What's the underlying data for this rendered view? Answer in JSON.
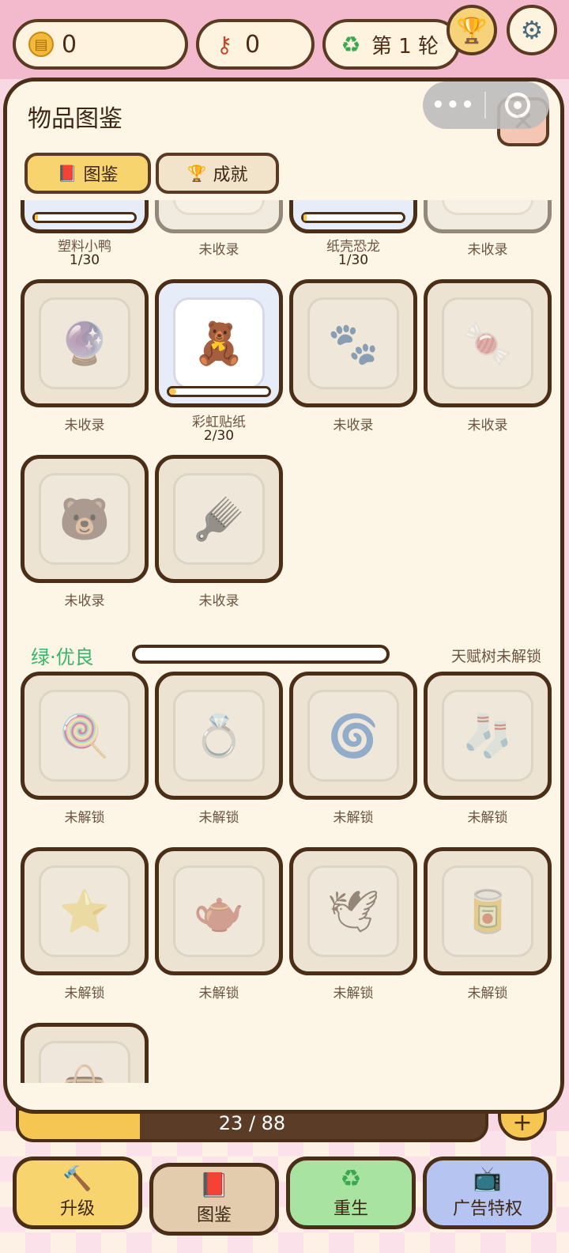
{
  "top_bar": {
    "coins": "0",
    "keys": "0",
    "round": "第 1 轮"
  },
  "panel": {
    "title": "物品图鉴",
    "capsule_more": "•••",
    "close": "✕"
  },
  "tabs": [
    {
      "label": "图鉴",
      "active": true
    },
    {
      "label": "成就",
      "active": false
    }
  ],
  "partial_row": [
    {
      "name": "塑料小鸭",
      "progress": "1/30",
      "collected": true
    },
    {
      "name": "未收录",
      "collected": false
    },
    {
      "name": "纸壳恐龙",
      "progress": "1/30",
      "collected": true
    },
    {
      "name": "未收录",
      "collected": false
    }
  ],
  "white_rows": [
    [
      {
        "name": "未收录",
        "icon": "marble-icon"
      },
      {
        "name": "彩虹贴纸",
        "progress": "2/30",
        "icon": "sticker-box-icon",
        "collected": true
      },
      {
        "name": "未收录",
        "icon": "sticker-sheet-icon"
      },
      {
        "name": "未收录",
        "icon": "swirl-candy-icon"
      }
    ],
    [
      {
        "name": "未收录",
        "icon": "keychain-set-icon"
      },
      {
        "name": "未收录",
        "icon": "comb-set-icon"
      }
    ]
  ],
  "green_section": {
    "title": "绿·优良",
    "status": "天赋树未解锁",
    "items": [
      {
        "name": "未解锁",
        "icon": "bear-lollipop-icon",
        "emoji": "🍭"
      },
      {
        "name": "未解锁",
        "icon": "heart-ring-icon",
        "emoji": "💍"
      },
      {
        "name": "未解锁",
        "icon": "mini-fan-icon",
        "emoji": "🌀"
      },
      {
        "name": "未解锁",
        "icon": "paw-sock-icon",
        "emoji": "🧦"
      },
      {
        "name": "未解锁",
        "icon": "star-lamp-icon",
        "emoji": "⭐"
      },
      {
        "name": "未解锁",
        "icon": "teapot-icon",
        "emoji": "🫖"
      },
      {
        "name": "未解锁",
        "icon": "paper-crane-icon",
        "emoji": "🕊"
      },
      {
        "name": "未解锁",
        "icon": "mint-tin-icon",
        "emoji": "🥫"
      },
      {
        "name": "",
        "icon": "bag-icon",
        "emoji": "👜"
      }
    ]
  },
  "exp_bar": {
    "text": "23 / 88",
    "progress": 0.26
  },
  "bottom_nav": [
    {
      "label": "升级",
      "icon": "hammer-icon",
      "color": "#f8d46f"
    },
    {
      "label": "图鉴",
      "icon": "book-icon",
      "color": "#e3ccae"
    },
    {
      "label": "重生",
      "icon": "recycle-icon",
      "color": "#a9e3a1"
    },
    {
      "label": "广告特权",
      "icon": "tv-icon",
      "color": "#b6c4f2"
    }
  ]
}
